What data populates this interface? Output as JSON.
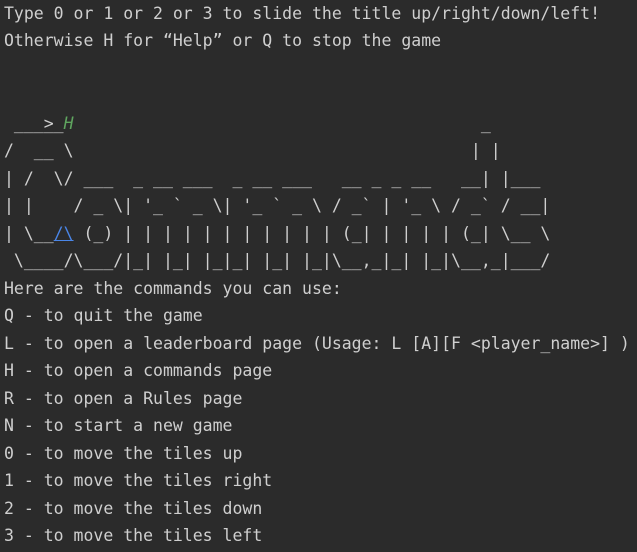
{
  "console": {
    "lines": [
      "Type 0 or 1 or 2 or 3 to slide the title up/right/down/left!",
      "Otherwise H for “Help” or Q to stop the game"
    ],
    "prompt_symbol": ">",
    "input_value": "H",
    "ascii_art": [
      " _____                                          _",
      "/  __ \\                                        | |",
      "| /  \\/ ___  _ __ ___  _ __ ___   __ _ _ __   __| |___",
      "| |    / _ \\| '_ ` _ \\| '_ ` _ \\ / _` | '_ \\ / _` / __|",
      "| \\__",
      "/\\",
      " (_) | | | | | | | | | | | (_| | | | | (_| \\__ \\",
      " \\____/\\___/|_| |_| |_|_| |_| |_|\\__,_|_| |_|\\__,_|___/"
    ],
    "help_header": "Here are the commands you can use:",
    "commands": [
      "Q - to quit the game",
      "L - to open a leaderboard page (Usage: L [A][F <player_name>] )",
      "H - to open a commands page",
      "R - to open a Rules page",
      "N - to start a new game",
      "0 - to move the tiles up",
      "1 - to move the tiles right",
      "2 - to move the tiles down",
      "3 - to move the tiles left"
    ],
    "input_color": "#5fa55f",
    "link_color": "#4a86e8",
    "background_color": "#2b2b2b",
    "text_color": "#cfcfcf"
  }
}
